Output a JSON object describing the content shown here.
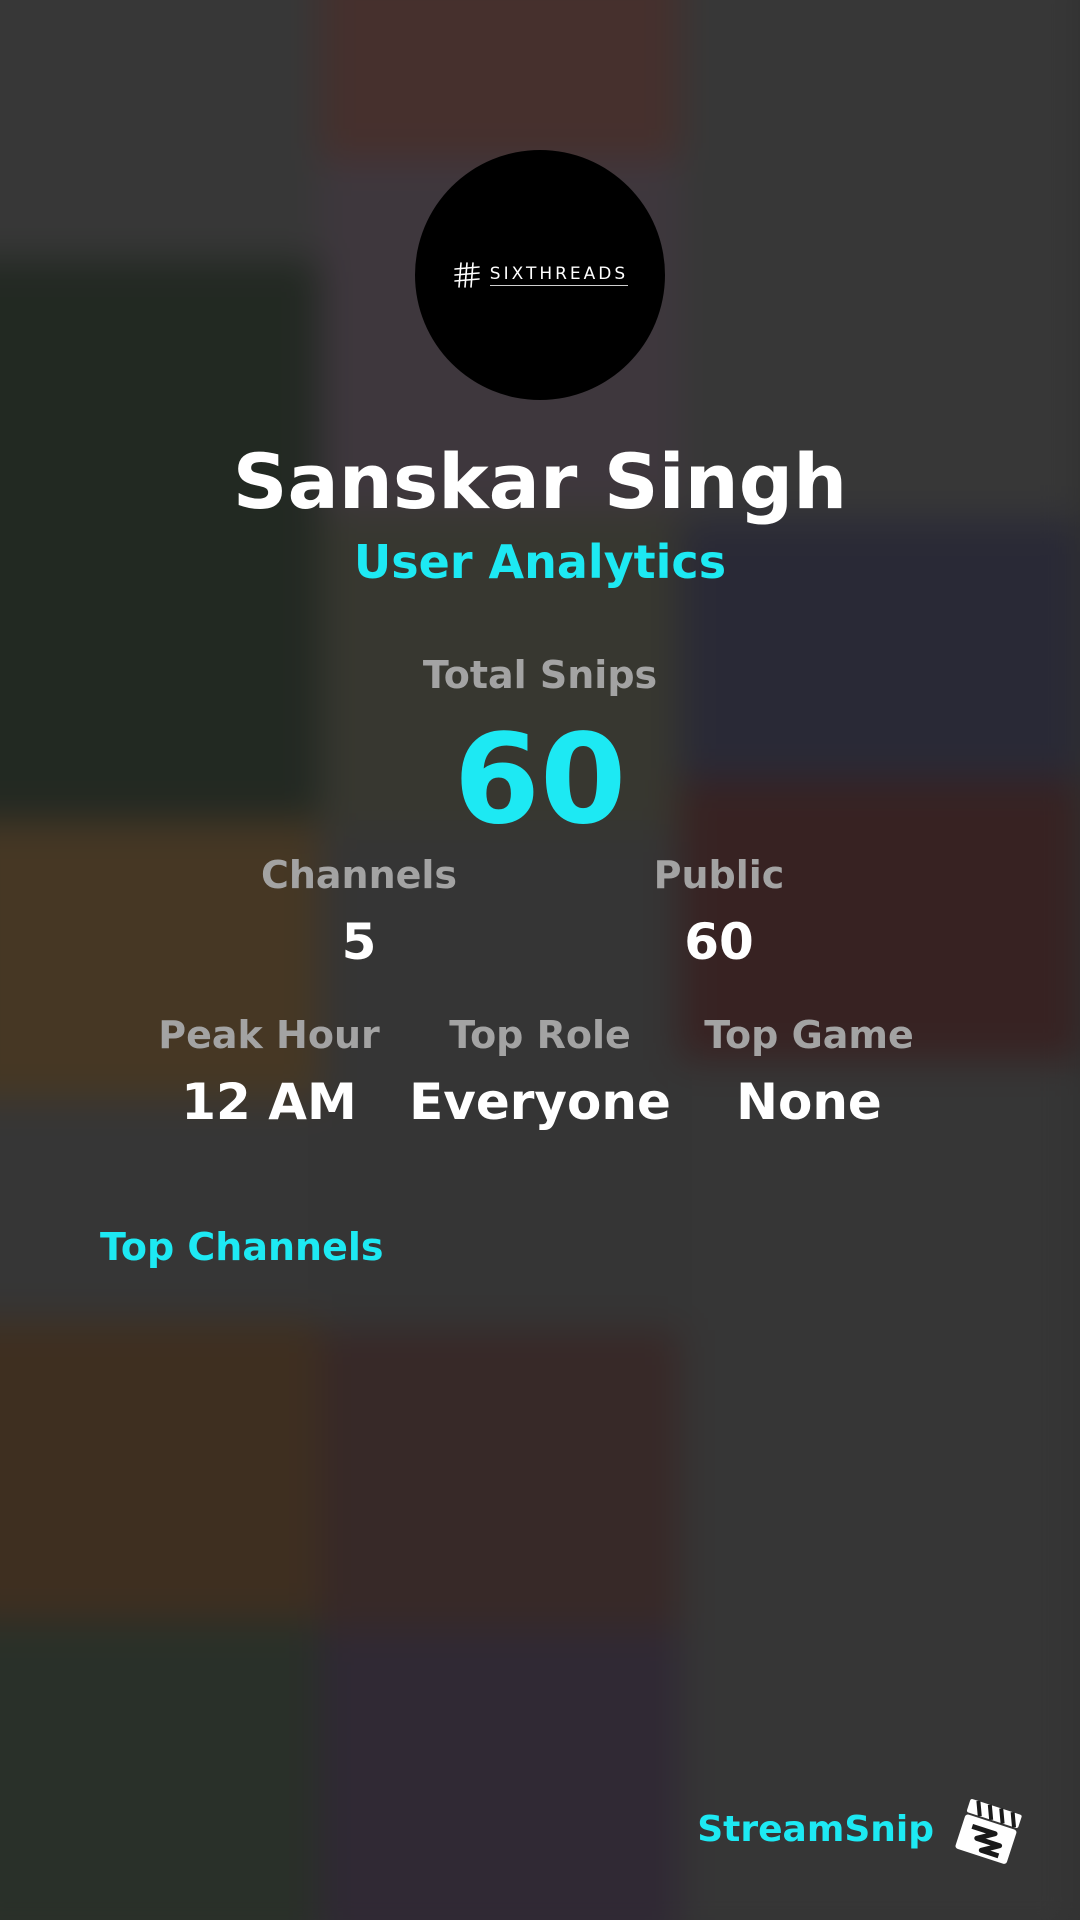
{
  "profile": {
    "name": "Sanskar Singh",
    "subtitle": "User Analytics",
    "avatar_logo_text": "SIXTHREADS"
  },
  "stats": {
    "total_snips": {
      "label": "Total Snips",
      "value": "60"
    },
    "channels": {
      "label": "Channels",
      "value": "5"
    },
    "public": {
      "label": "Public",
      "value": "60"
    },
    "peak_hour": {
      "label": "Peak Hour",
      "value": "12 AM"
    },
    "top_role": {
      "label": "Top Role",
      "value": "Everyone"
    },
    "top_game": {
      "label": "Top Game",
      "value": "None"
    }
  },
  "sections": {
    "top_channels": "Top Channels"
  },
  "brand": {
    "name": "StreamSnip"
  },
  "colors": {
    "accent": "#1de9f3",
    "label": "#a3a3a3",
    "text": "#ffffff",
    "background": "#3a3a3a"
  },
  "icons": {
    "avatar_mark": "sixthreads-grid-icon",
    "brand_logo": "streamsnip-clapperboard-icon"
  }
}
